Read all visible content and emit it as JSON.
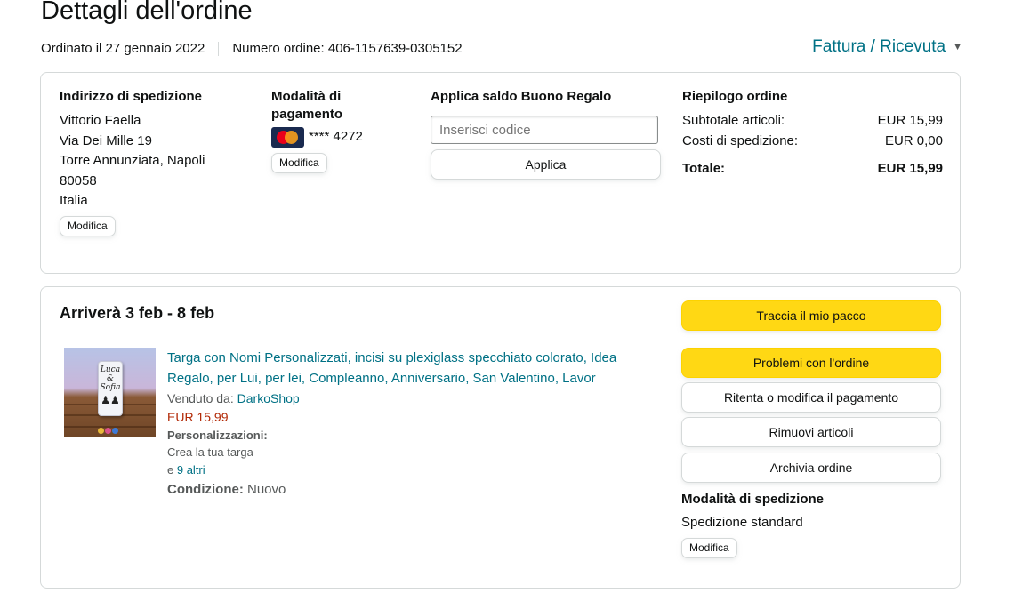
{
  "header": {
    "title": "Dettagli dell'ordine",
    "ordered_on": "Ordinato il 27 gennaio 2022",
    "order_number": "Numero ordine: 406-1157639-0305152",
    "invoice_link": "Fattura / Ricevuta",
    "invoice_icon": "chevron-down-icon"
  },
  "summary": {
    "shipping_address": {
      "heading": "Indirizzo di spedizione",
      "lines": [
        "Vittorio Faella",
        "Via Dei Mille 19",
        "Torre Annunziata, Napoli",
        "80058",
        "Italia"
      ],
      "edit_label": "Modifica"
    },
    "payment": {
      "heading_line1": "Modalità di",
      "heading_line2": "pagamento",
      "card_icon": "mastercard-icon",
      "card_brand_colors": [
        "#eb001b",
        "#f79e1b"
      ],
      "card_number": "**** 4272",
      "edit_label": "Modifica"
    },
    "gift_card": {
      "heading": "Applica saldo Buono Regalo",
      "placeholder": "Inserisci codice",
      "apply_label": "Applica"
    },
    "order_summary": {
      "heading": "Riepilogo ordine",
      "subtotal_label": "Subtotale articoli:",
      "subtotal_value": "EUR 15,99",
      "shipping_label": "Costi di spedizione:",
      "shipping_value": "EUR 0,00",
      "total_label": "Totale:",
      "total_value": "EUR 15,99"
    }
  },
  "shipment": {
    "arrival": "Arriverà 3 feb - 8 feb",
    "item": {
      "image_text_1": "Luca",
      "image_text_2": "&",
      "image_text_3": "Sofia",
      "title_line1": "Targa con Nomi Personalizzati, incisi su plexiglass specchiato colorato, Idea",
      "title_line2": "Regalo, per Lui, per lei, Compleanno, Anniversario, San Valentino, Lavor",
      "sold_by_label": "Venduto da:",
      "seller": "DarkoShop",
      "price": "EUR 15,99",
      "customizations_label": "Personalizzazioni:",
      "customization_value": "Crea la tua targa",
      "more_prefix": "e",
      "more_link": "9 altri",
      "condition_label": "Condizione:",
      "condition_value": "Nuovo"
    },
    "actions": {
      "track": "Traccia il mio pacco",
      "problems": "Problemi con l'ordine",
      "retry_payment": "Ritenta o modifica il pagamento",
      "remove_items": "Rimuovi articoli",
      "archive": "Archivia ordine"
    },
    "shipping_method": {
      "heading": "Modalità di spedizione",
      "value": "Spedizione standard",
      "edit_label": "Modifica"
    }
  },
  "colors": {
    "link": "#007185",
    "price": "#B12704",
    "primary_button": "#FFD814",
    "border": "#D5D9D9"
  }
}
